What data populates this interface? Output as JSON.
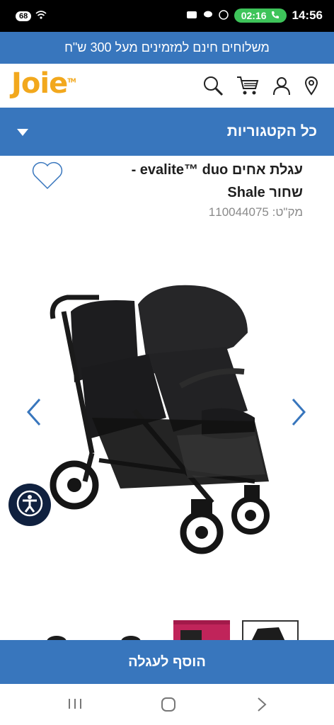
{
  "status_bar": {
    "left_badge": "68",
    "call_time": "02:16",
    "clock": "14:56"
  },
  "promo": {
    "text": "משלוחים חינם למזמינים מעל 300 ש\"ח"
  },
  "header": {
    "logo": "Joie",
    "icons": [
      "search-icon",
      "cart-icon",
      "user-icon",
      "location-icon"
    ]
  },
  "category_bar": {
    "label": "כל הקטגוריות"
  },
  "product": {
    "title_line1": "עגלת אחים evalite™ duo -",
    "title_line2": "שחור Shale",
    "sku": "מק\"ט: 110044075"
  },
  "actions": {
    "add_to_cart": "הוסף לעגלה"
  },
  "colors": {
    "brand_blue": "#3876bd",
    "logo_orange": "#f2a81d",
    "accessibility_navy": "#10213f"
  }
}
